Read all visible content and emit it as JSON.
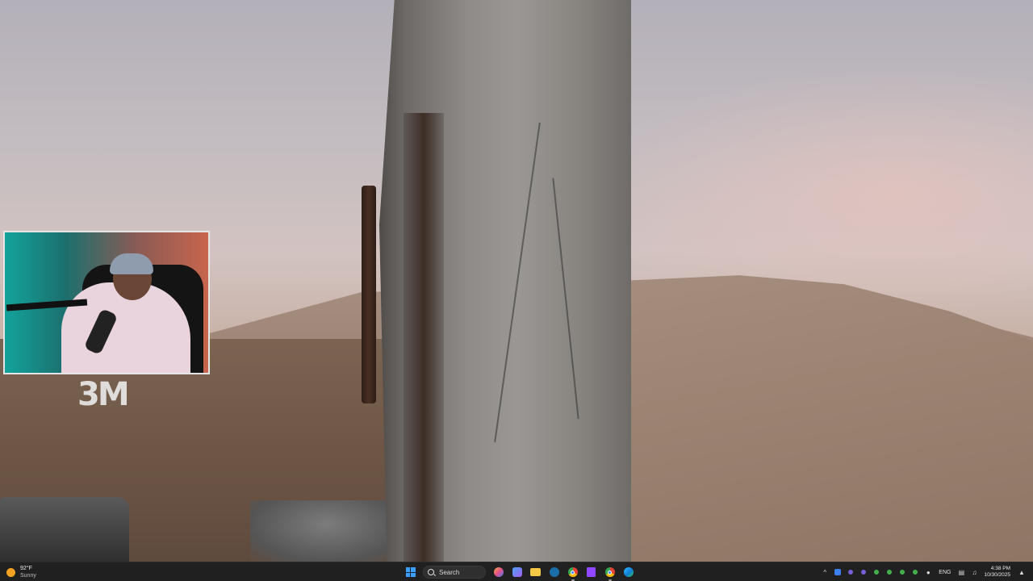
{
  "overlay": {
    "logo_text": "3M"
  },
  "taskbar": {
    "weather": {
      "temperature": "92°F",
      "condition": "Sunny"
    },
    "search_label": "Search",
    "pinned_apps": [
      "copilot-icon",
      "file-explorer-icon",
      "steam-icon",
      "chrome-icon",
      "twitch-icon",
      "edge-icon"
    ],
    "tray": {
      "language": "ENG",
      "time": "4:38 PM",
      "date": "10/30/2025"
    }
  },
  "colors": {
    "taskbar_bg": "#202020",
    "windows_blue": "#3aa0ff",
    "webcam_border": "#e5e5e5"
  }
}
